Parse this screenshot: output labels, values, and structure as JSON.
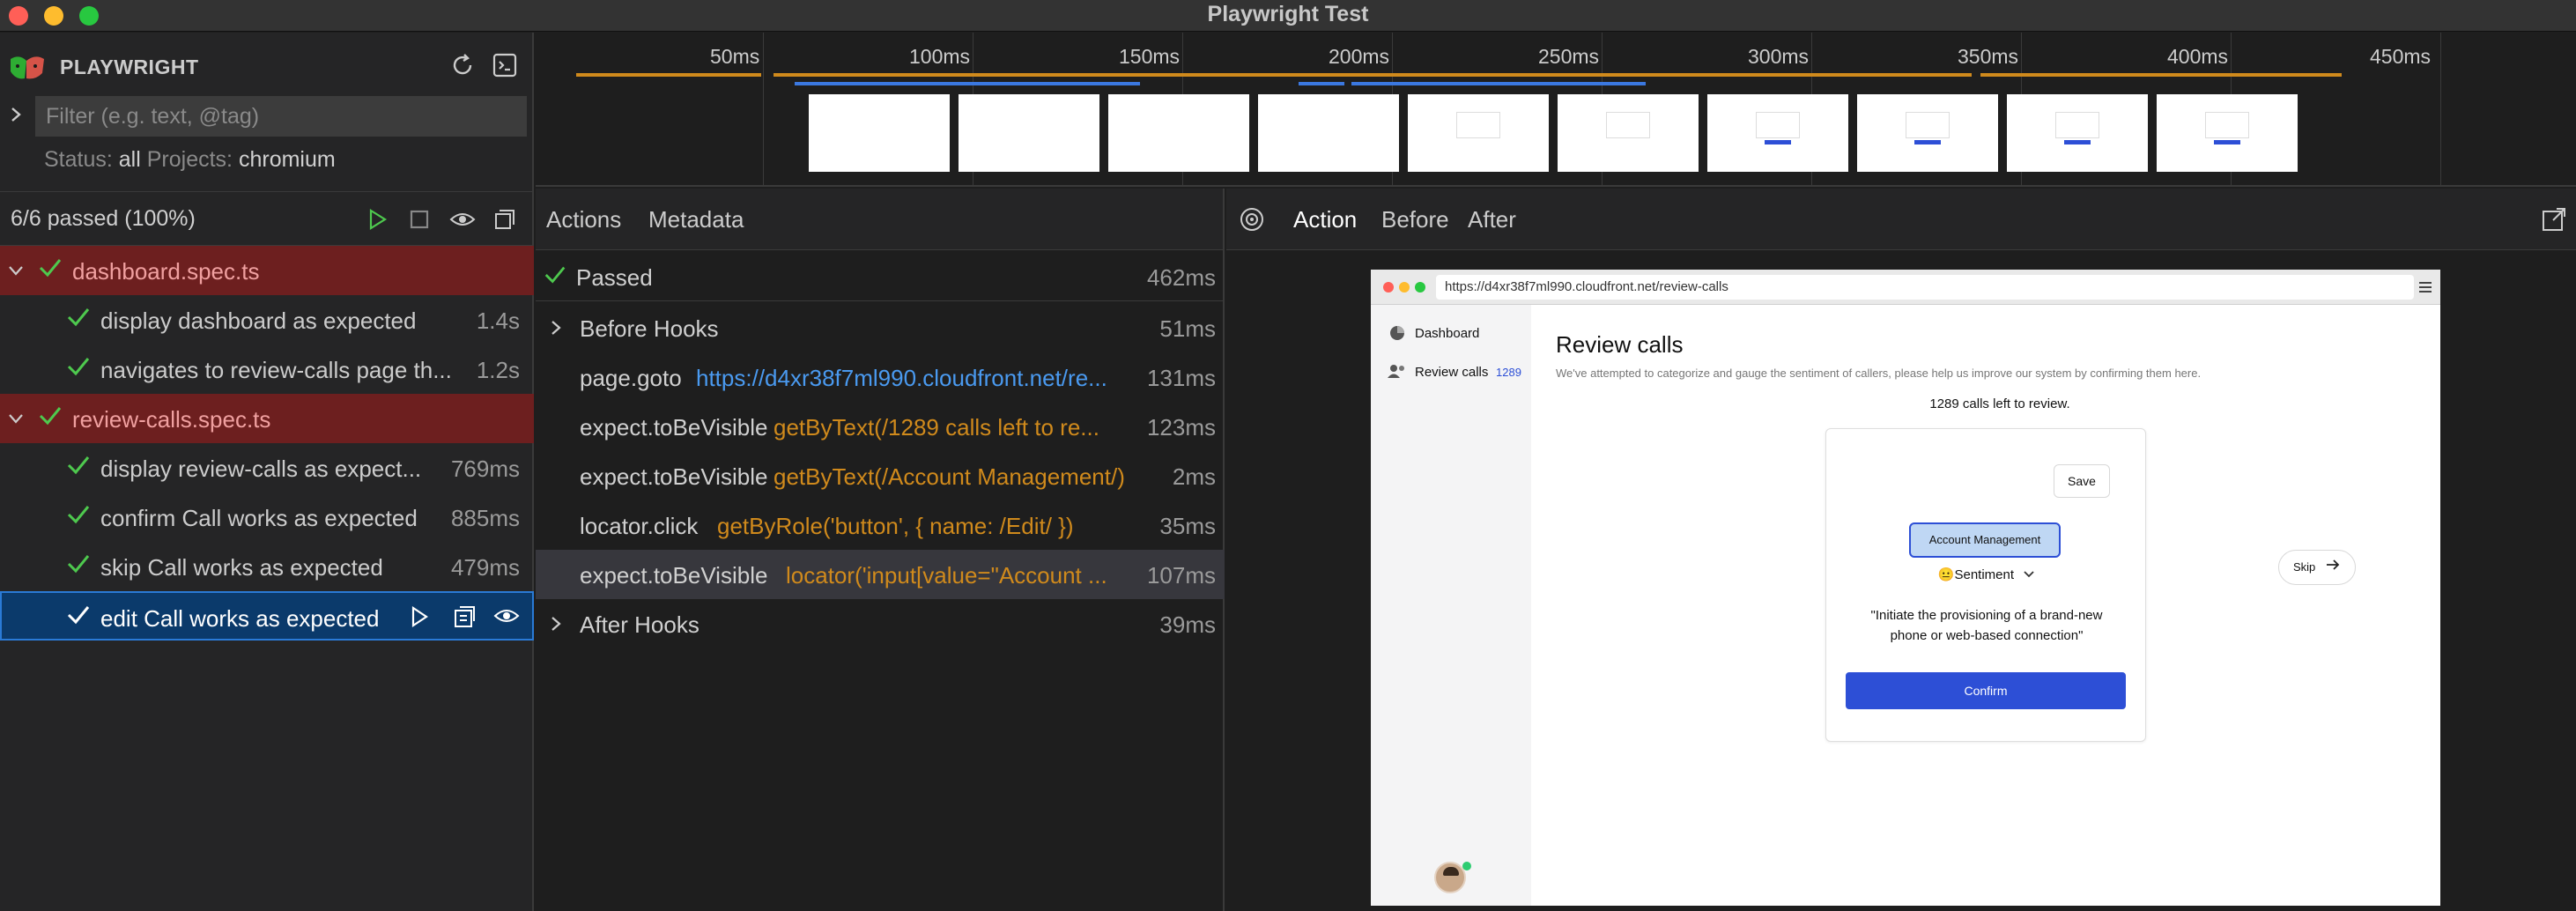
{
  "window": {
    "title": "Playwright Test"
  },
  "sidebar": {
    "brand": "PLAYWRIGHT",
    "filter_placeholder": "Filter (e.g. text, @tag)",
    "status_label": "Status:",
    "status_value": "all",
    "projects_label": "Projects:",
    "projects_value": "chromium",
    "summary": "6/6 passed (100%)",
    "tree": [
      {
        "type": "file",
        "label": "dashboard.spec.ts"
      },
      {
        "type": "test",
        "label": "display dashboard as expected",
        "duration": "1.4s"
      },
      {
        "type": "test",
        "label": "navigates to review-calls page th...",
        "duration": "1.2s"
      },
      {
        "type": "file",
        "label": "review-calls.spec.ts"
      },
      {
        "type": "test",
        "label": "display review-calls as expect...",
        "duration": "769ms"
      },
      {
        "type": "test",
        "label": "confirm Call works as expected",
        "duration": "885ms"
      },
      {
        "type": "test",
        "label": "skip Call works as expected",
        "duration": "479ms"
      },
      {
        "type": "test",
        "label": "edit Call works as expected",
        "duration": "",
        "selected": true
      }
    ]
  },
  "timeline": {
    "ticks": [
      "50ms",
      "100ms",
      "150ms",
      "200ms",
      "250ms",
      "300ms",
      "350ms",
      "400ms",
      "450ms"
    ]
  },
  "actions_panel": {
    "tabs": [
      "Actions",
      "Metadata"
    ],
    "passed_label": "Passed",
    "passed_duration": "462ms",
    "rows": [
      {
        "kind": "group",
        "name": "Before Hooks",
        "arg": "",
        "duration": "51ms"
      },
      {
        "kind": "action",
        "name": "page.goto",
        "arg": "https://d4xr38f7ml990.cloudfront.net/re...",
        "arg_color": "blue",
        "duration": "131ms"
      },
      {
        "kind": "action",
        "name": "expect.toBeVisible",
        "arg": "getByText(/1289 calls left to re...",
        "arg_color": "orange",
        "duration": "123ms"
      },
      {
        "kind": "action",
        "name": "expect.toBeVisible",
        "arg": "getByText(/Account Management/)",
        "arg_color": "orange",
        "duration": "2ms"
      },
      {
        "kind": "action",
        "name": "locator.click",
        "arg": "getByRole('button', { name: /Edit/ })",
        "arg_color": "orange",
        "duration": "35ms"
      },
      {
        "kind": "action",
        "name": "expect.toBeVisible",
        "arg": "locator('input[value=\"Account ...",
        "arg_color": "orange",
        "duration": "107ms",
        "selected": true
      },
      {
        "kind": "group",
        "name": "After Hooks",
        "arg": "",
        "duration": "39ms"
      }
    ]
  },
  "preview_panel": {
    "tabs": [
      "Action",
      "Before",
      "After"
    ],
    "url": "https://d4xr38f7ml990.cloudfront.net/review-calls",
    "nav": [
      {
        "label": "Dashboard",
        "badge": ""
      },
      {
        "label": "Review calls",
        "badge": "1289"
      }
    ],
    "page_title": "Review calls",
    "page_subtitle": "We've attempted to categorize and gauge the sentiment of callers, please help us improve our system by confirming them here.",
    "calls_left": "1289 calls left to review.",
    "save_label": "Save",
    "category_value": "Account Management",
    "sentiment_label": "Sentiment",
    "quote": "\"Initiate the provisioning of a brand-new phone or web-based connection\"",
    "confirm_label": "Confirm",
    "skip_label": "Skip"
  },
  "colors": {
    "orange": "#d08a1c",
    "blue": "#3b78e0",
    "pass_green": "#4ec94e",
    "file_row_bg": "#6d1f1f",
    "selected_bg": "#0b3a6b",
    "confirm_blue": "#2d4fd6"
  }
}
